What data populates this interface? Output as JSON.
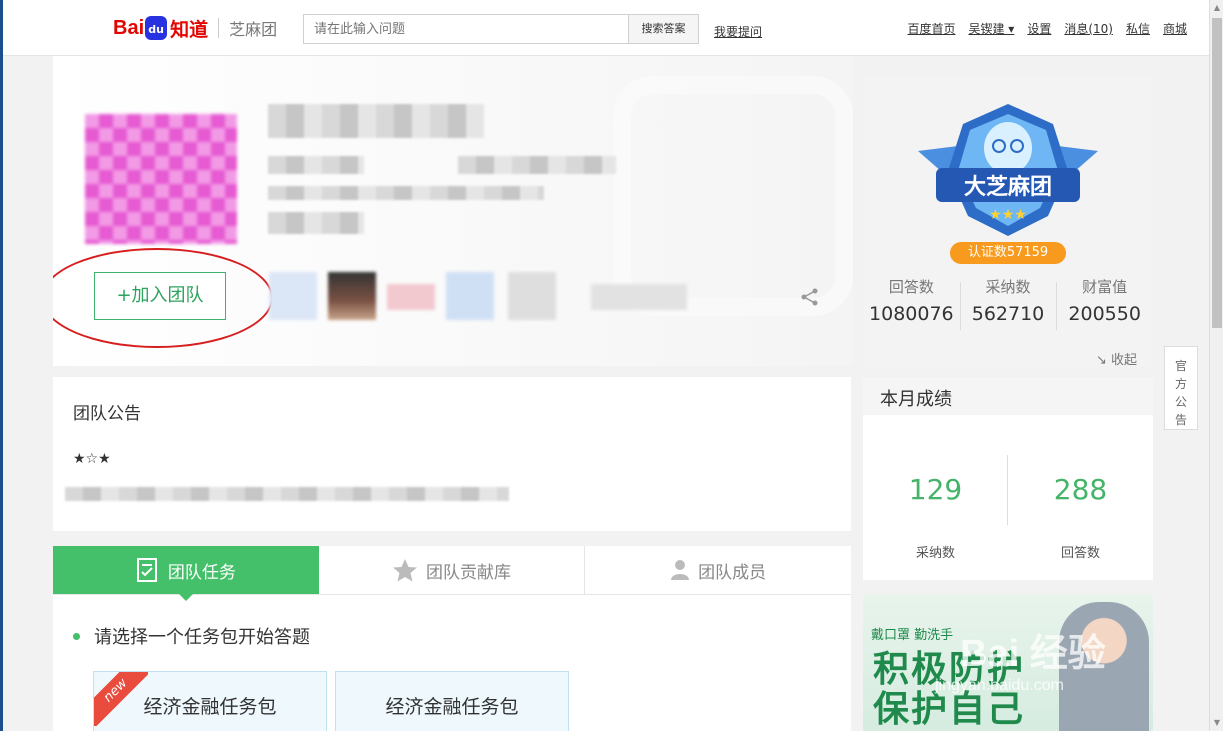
{
  "header": {
    "logo_bai": "Bai",
    "logo_du": "du",
    "logo_zhidao": "知道",
    "team_name": "芝麻团",
    "search_placeholder": "请在此输入问题",
    "search_button": "搜索答案",
    "ask_link": "我要提问",
    "nav": [
      "百度首页",
      "吴锲建 ▾",
      "设置",
      "消息(10)",
      "私信",
      "商城"
    ]
  },
  "hero": {
    "join_button": "+加入团队"
  },
  "badge": {
    "title": "大芝麻团",
    "cert_count": "认证数57159",
    "stats": [
      {
        "label": "回答数",
        "value": "1080076"
      },
      {
        "label": "采纳数",
        "value": "562710"
      },
      {
        "label": "财富值",
        "value": "200550"
      }
    ],
    "collapse": "↘ 收起"
  },
  "side_tab": {
    "label": "官方公告"
  },
  "announcement": {
    "title": "团队公告",
    "stars": "★☆★"
  },
  "tabs": [
    {
      "label": "团队任务",
      "icon": "task-icon"
    },
    {
      "label": "团队贡献库",
      "icon": "star-icon"
    },
    {
      "label": "团队成员",
      "icon": "person-icon"
    }
  ],
  "tasks": {
    "prompt": "请选择一个任务包开始答题",
    "packages": [
      "经济金融任务包",
      "经济金融任务包"
    ],
    "new_tag": "new"
  },
  "monthly": {
    "title": "本月成绩",
    "adopted": {
      "value": "129",
      "label": "采纳数"
    },
    "answers": {
      "value": "288",
      "label": "回答数"
    }
  },
  "ad": {
    "small": "戴口罩 勤洗手",
    "slogan_line1": "积极防护",
    "slogan_line2": "保护自己"
  },
  "watermark": {
    "main": "Bai 经验",
    "url": "jingyan.baidu.com"
  },
  "colors": {
    "accent_green": "#45c06a",
    "baidu_red": "#e10601",
    "badge_orange": "#f79a1d"
  }
}
